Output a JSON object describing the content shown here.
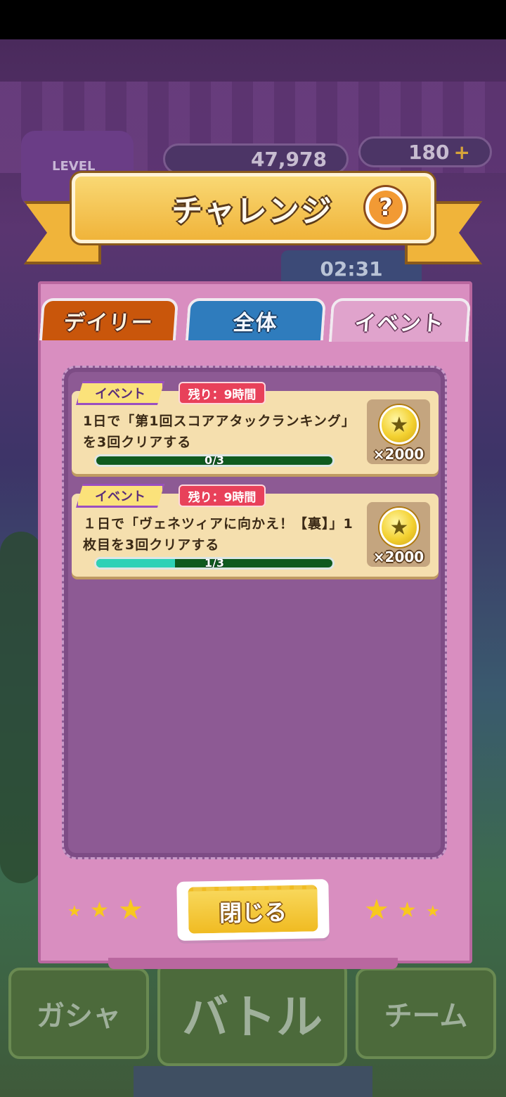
{
  "background": {
    "coins": "47,978",
    "gems": "180",
    "gems_plus": "+",
    "level_label": "LEVEL",
    "timer": "02:31",
    "nav_gacha": "ガシャ",
    "nav_battle": "バトル",
    "nav_team": "チーム"
  },
  "header": {
    "title": "チャレンジ",
    "help_label": "?"
  },
  "tabs": [
    {
      "label": "デイリー"
    },
    {
      "label": "全体"
    },
    {
      "label": "イベント",
      "active": true
    }
  ],
  "challenges": [
    {
      "badge": "イベント",
      "remaining": "残り：9時間",
      "description": "1日で「第1回スコアアタックランキング」を3回クリアする",
      "progress_text": "0/3",
      "progress_fraction": 0.0,
      "reward_quantity": "×2000",
      "reward_icon": "gold-star-coin-icon"
    },
    {
      "badge": "イベント",
      "remaining": "残り：9時間",
      "description": "１日で「ヴェネツィアに向かえ！【裏】」1枚目を3回クリアする",
      "progress_text": "1/3",
      "progress_fraction": 0.333,
      "reward_quantity": "×2000",
      "reward_icon": "gold-star-coin-icon"
    }
  ],
  "footer": {
    "close_label": "閉じる"
  },
  "colors": {
    "modal_pink": "#d98ec0",
    "panel_purple": "#8d5a94",
    "card_cream": "#f5dfae",
    "progress_fill": "#2ed1b6",
    "progress_track": "#0f5a1e",
    "time_badge_red": "#e8415a",
    "button_yellow": "#f0bb22"
  }
}
